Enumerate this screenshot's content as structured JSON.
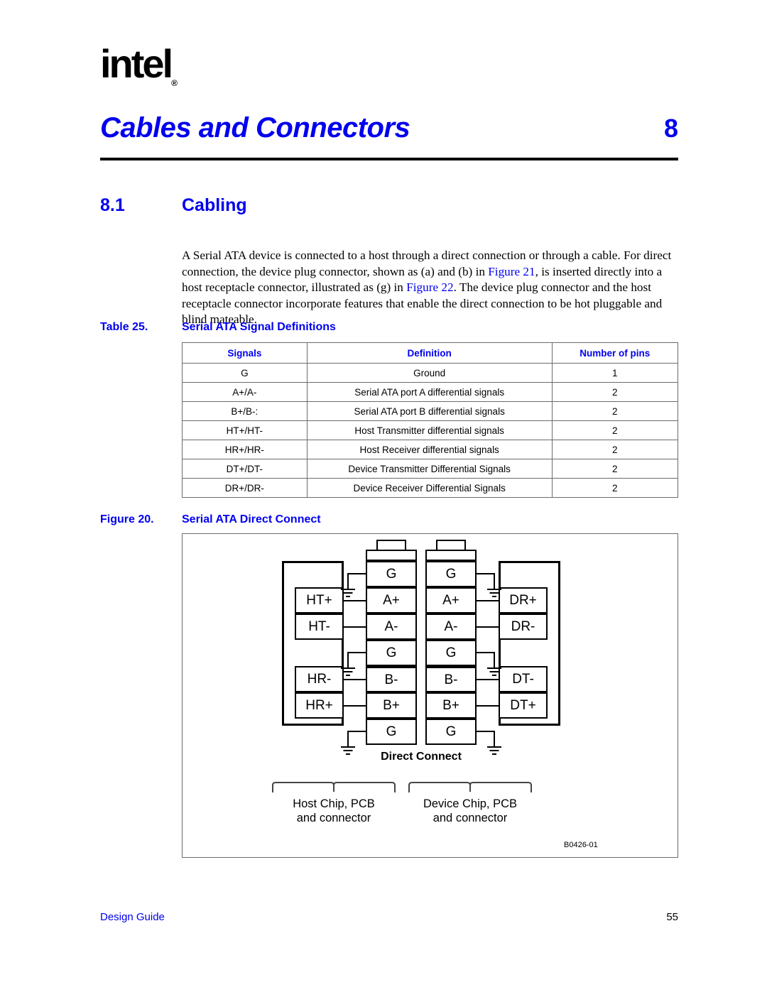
{
  "logo": {
    "text": "intel",
    "registered": "®"
  },
  "chapter": {
    "title": "Cables and Connectors",
    "number": "8"
  },
  "section": {
    "number": "8.1",
    "title": "Cabling"
  },
  "body": {
    "p1_a": "A Serial ATA device is connected to a host through a direct connection or through a cable. For direct connection, the device plug connector, shown as (a) and (b) in ",
    "p1_ref1": "Figure 21",
    "p1_b": ", is inserted directly into a host receptacle connector, illustrated as (g) in ",
    "p1_ref2": "Figure 22",
    "p1_c": ". The device plug connector and the host receptacle connector incorporate features that enable the direct connection to be hot pluggable and blind mateable."
  },
  "table": {
    "label": "Table 25.",
    "title": "Serial ATA Signal Definitions",
    "headers": [
      "Signals",
      "Definition",
      "Number of pins"
    ],
    "rows": [
      [
        "G",
        "Ground",
        "1"
      ],
      [
        "A+/A-",
        "Serial ATA port A differential signals",
        "2"
      ],
      [
        "B+/B-:",
        "Serial ATA port B differential signals",
        "2"
      ],
      [
        "HT+/HT-",
        "Host Transmitter differential signals",
        "2"
      ],
      [
        "HR+/HR-",
        "Host Receiver differential signals",
        "2"
      ],
      [
        "DT+/DT-",
        "Device Transmitter Differential Signals",
        "2"
      ],
      [
        "DR+/DR-",
        "Device Receiver Differential Signals",
        "2"
      ]
    ]
  },
  "figure": {
    "label": "Figure 20.",
    "title": "Serial ATA Direct Connect",
    "host_pins": [
      "HT+",
      "HT-",
      "HR-",
      "HR+"
    ],
    "host_connector_pins": [
      "G",
      "A+",
      "A-",
      "G",
      "B-",
      "B+",
      "G"
    ],
    "device_connector_pins": [
      "G",
      "A+",
      "A-",
      "G",
      "B-",
      "B+",
      "G"
    ],
    "device_pins": [
      "DR+",
      "DR-",
      "DT-",
      "DT+"
    ],
    "center_label": "Direct Connect",
    "host_group_label_line1": "Host Chip, PCB",
    "host_group_label_line2": "and connector",
    "device_group_label_line1": "Device Chip, PCB",
    "device_group_label_line2": "and connector",
    "figure_id": "B0426-01"
  },
  "footer": {
    "left": "Design Guide",
    "right": "55"
  },
  "colors": {
    "accent": "#0000ee",
    "text": "#000000",
    "rule": "#6b6b6b"
  }
}
